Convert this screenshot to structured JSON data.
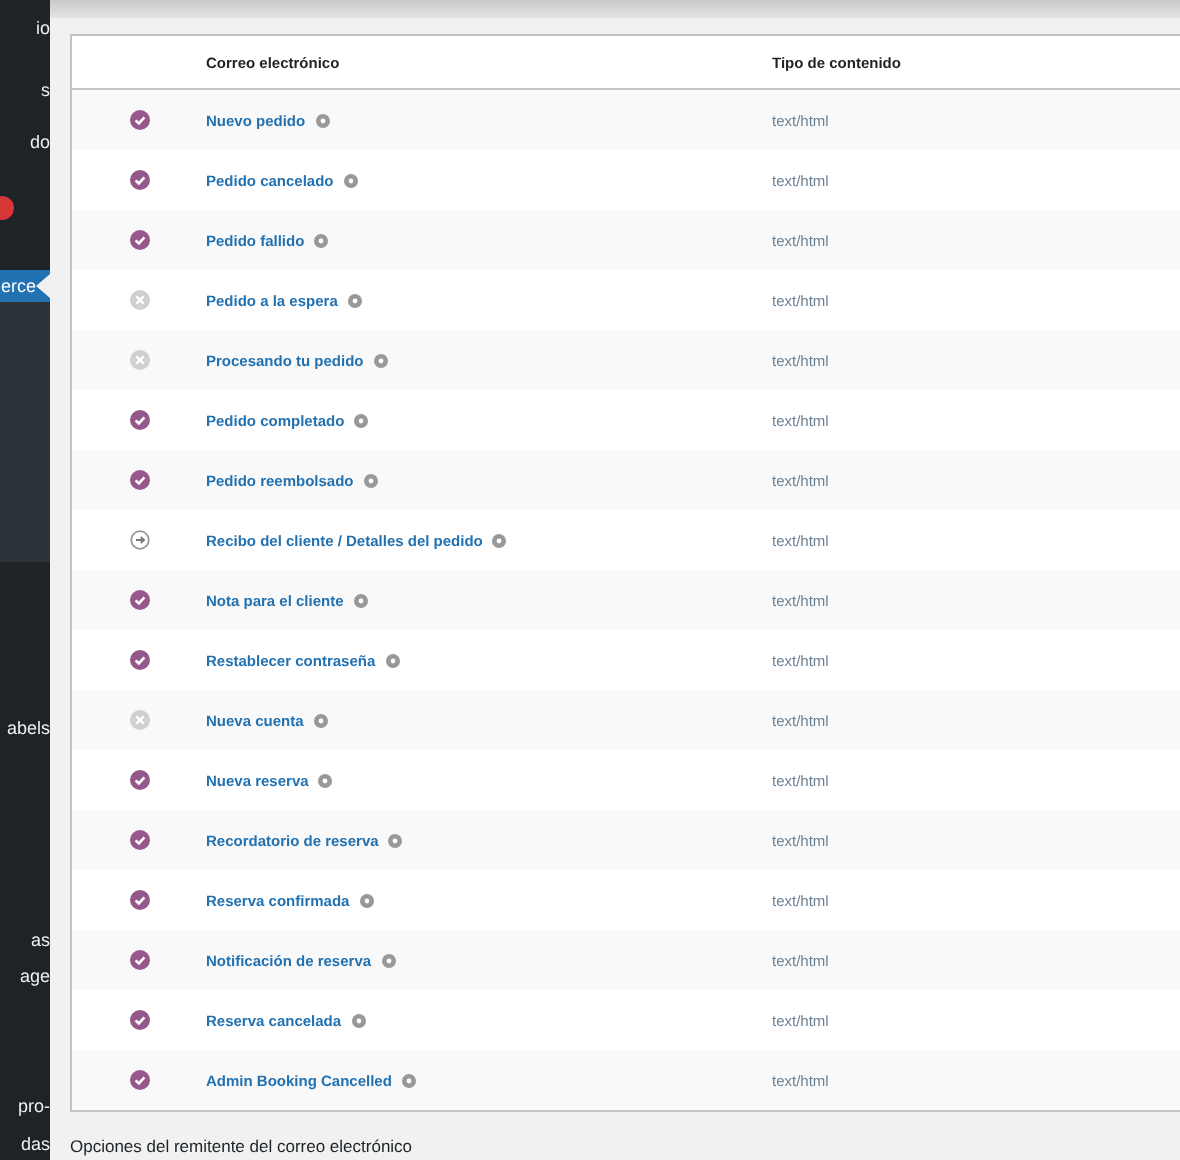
{
  "sidebar": {
    "items": [
      {
        "label": "io",
        "selected": false
      },
      {
        "label": "s",
        "selected": false
      },
      {
        "label": "do",
        "selected": false
      },
      {
        "label": "erce",
        "selected": true
      },
      {
        "label": "abels",
        "selected": false
      },
      {
        "label": "as",
        "selected": false
      },
      {
        "label": "age",
        "selected": false
      },
      {
        "label": "pro-",
        "selected": false
      },
      {
        "label": "das",
        "selected": false
      }
    ],
    "badge": true
  },
  "table": {
    "columns": [
      "Correo electrónico",
      "Tipo de contenido"
    ],
    "rows": [
      {
        "kind": "enabled",
        "name": "Nuevo pedido",
        "type": "text/html"
      },
      {
        "kind": "enabled",
        "name": "Pedido cancelado",
        "type": "text/html"
      },
      {
        "kind": "enabled",
        "name": "Pedido fallido",
        "type": "text/html"
      },
      {
        "kind": "disabled",
        "name": "Pedido a la espera",
        "type": "text/html"
      },
      {
        "kind": "disabled",
        "name": "Procesando tu pedido",
        "type": "text/html"
      },
      {
        "kind": "enabled",
        "name": "Pedido completado",
        "type": "text/html"
      },
      {
        "kind": "enabled",
        "name": "Pedido reembolsado",
        "type": "text/html"
      },
      {
        "kind": "manual",
        "name": "Recibo del cliente / Detalles del pedido",
        "type": "text/html"
      },
      {
        "kind": "enabled",
        "name": "Nota para el cliente",
        "type": "text/html"
      },
      {
        "kind": "enabled",
        "name": "Restablecer contraseña",
        "type": "text/html"
      },
      {
        "kind": "disabled",
        "name": "Nueva cuenta",
        "type": "text/html"
      },
      {
        "kind": "enabled",
        "name": "Nueva reserva",
        "type": "text/html"
      },
      {
        "kind": "enabled",
        "name": "Recordatorio de reserva",
        "type": "text/html"
      },
      {
        "kind": "enabled",
        "name": "Reserva confirmada",
        "type": "text/html"
      },
      {
        "kind": "enabled",
        "name": "Notificación de reserva",
        "type": "text/html"
      },
      {
        "kind": "enabled",
        "name": "Reserva cancelada",
        "type": "text/html"
      },
      {
        "kind": "enabled",
        "name": "Admin Booking Cancelled",
        "type": "text/html"
      }
    ]
  },
  "section_title": "Opciones del remitente del correo electrónico"
}
